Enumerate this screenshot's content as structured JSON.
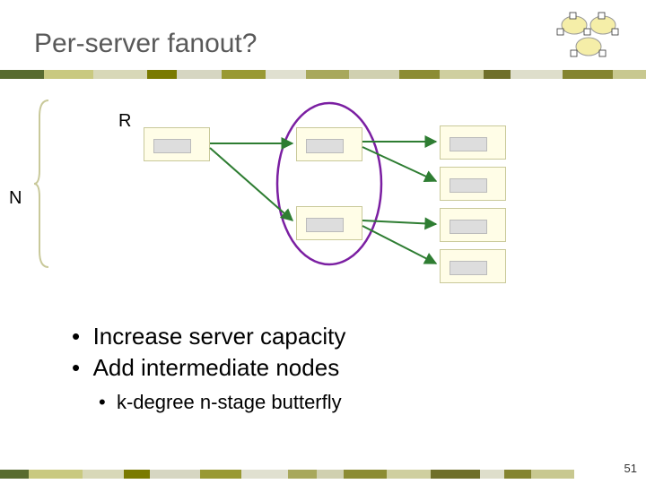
{
  "title": "Per-server fanout?",
  "labels": {
    "R": "R",
    "N": "N"
  },
  "bullets": {
    "b1": "Increase server capacity",
    "b2": "Add intermediate nodes",
    "sub": "k-degree n-stage butterfly"
  },
  "page_number": "51",
  "colorbar": [
    "#586b2f",
    "#c9c980",
    "#d8d8b8",
    "#7a7a00",
    "#d6d6c2",
    "#999933",
    "#e0e0d0",
    "#a8a85c",
    "#d0d0b0",
    "#8c8c33",
    "#cfcfa0",
    "#6f6f2a",
    "#dedecb",
    "#848430",
    "#c8c890"
  ],
  "chart_data": {
    "type": "diagram",
    "description": "Fanout topology: 1 origin server (labeled R) sends to 2 intermediate servers, which send to 4 destination servers. Vertical brace labeled N over destination column. One intermediate pair is circled (highlighted).",
    "columns": [
      {
        "role": "origin",
        "count": 1,
        "label": "R"
      },
      {
        "role": "intermediate",
        "count": 2,
        "highlighted": true
      },
      {
        "role": "destination",
        "count": 4,
        "brace_label": "N"
      }
    ],
    "edges": [
      {
        "from": "origin-0",
        "to": "intermediate-0"
      },
      {
        "from": "origin-0",
        "to": "intermediate-1"
      },
      {
        "from": "intermediate-0",
        "to": "destination-0"
      },
      {
        "from": "intermediate-0",
        "to": "destination-1"
      },
      {
        "from": "intermediate-1",
        "to": "destination-2"
      },
      {
        "from": "intermediate-1",
        "to": "destination-3"
      }
    ]
  }
}
